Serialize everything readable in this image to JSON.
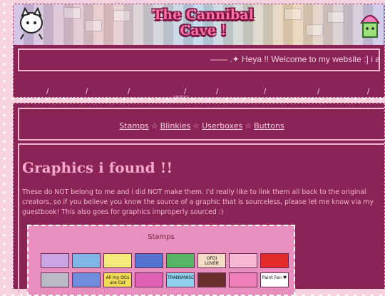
{
  "header": {
    "title": "The Cannibal Cave !",
    "marquee": "—— .✦ Heya !! Welcome to my website :] i appreciate"
  },
  "nav": {
    "separators": [
      "/",
      "/",
      "/",
      "/",
      "/",
      "/",
      "/",
      "/"
    ],
    "visitors_label": "visitors"
  },
  "links": {
    "items": [
      "Stamps",
      "Blinkies",
      "Userboxes",
      "Buttons"
    ],
    "separator": "☆"
  },
  "content": {
    "heading": "Graphics i found !!",
    "intro": "These do NOT belong to me and i did NOT make them. I'd really like to link them all back to the original creators, so if you believe you know the source of a graphic that is sourceless, please let me know via my guestbook! This also goes for graphics improperly sourced :)"
  },
  "stamps": {
    "label": "Stamps",
    "row1": [
      {
        "name": "stamp-lavender-character",
        "text": "",
        "bg": "#c9a6e3"
      },
      {
        "name": "stamp-blue-character",
        "text": "",
        "bg": "#7fb6e6"
      },
      {
        "name": "stamp-yellow-blob",
        "text": "",
        "bg": "#f4ec7a"
      },
      {
        "name": "stamp-blue-faces",
        "text": "",
        "bg": "#5574d1"
      },
      {
        "name": "stamp-green-creature",
        "text": "",
        "bg": "#56b565"
      },
      {
        "name": "stamp-ofdi-lover",
        "text": "OFDI LOVER",
        "bg": "#f4dcc6"
      },
      {
        "name": "stamp-pink-scene",
        "text": "",
        "bg": "#f6b8d2"
      },
      {
        "name": "stamp-red-smiley",
        "text": "",
        "bg": "#e32b2b"
      }
    ],
    "row2": [
      {
        "name": "stamp-gray-character",
        "text": "",
        "bg": "#b9b9c7"
      },
      {
        "name": "stamp-blue-dots",
        "text": "",
        "bg": "#6e8ddc"
      },
      {
        "name": "stamp-all-my-friends",
        "text": "All my OCs are Cat",
        "bg": "#f1dc55"
      },
      {
        "name": "stamp-pink-green",
        "text": "",
        "bg": "#e05fb6"
      },
      {
        "name": "stamp-trans-flag",
        "text": "TRANSMASC",
        "bg": "#8fd0ef"
      },
      {
        "name": "stamp-eyes",
        "text": "",
        "bg": "#6a2f2f"
      },
      {
        "name": "stamp-pink-hair",
        "text": "",
        "bg": "#ef7fb9"
      },
      {
        "name": "stamp-paint-fan",
        "text": "Paint Fan ♥",
        "bg": "#ffffff"
      }
    ]
  },
  "colors": {
    "page_bg": "#f6d3df",
    "panel_bg": "#8b2456",
    "border": "#f3b6cf",
    "heading": "#f7a8cc",
    "stamps_panel": "#e98fbf"
  }
}
